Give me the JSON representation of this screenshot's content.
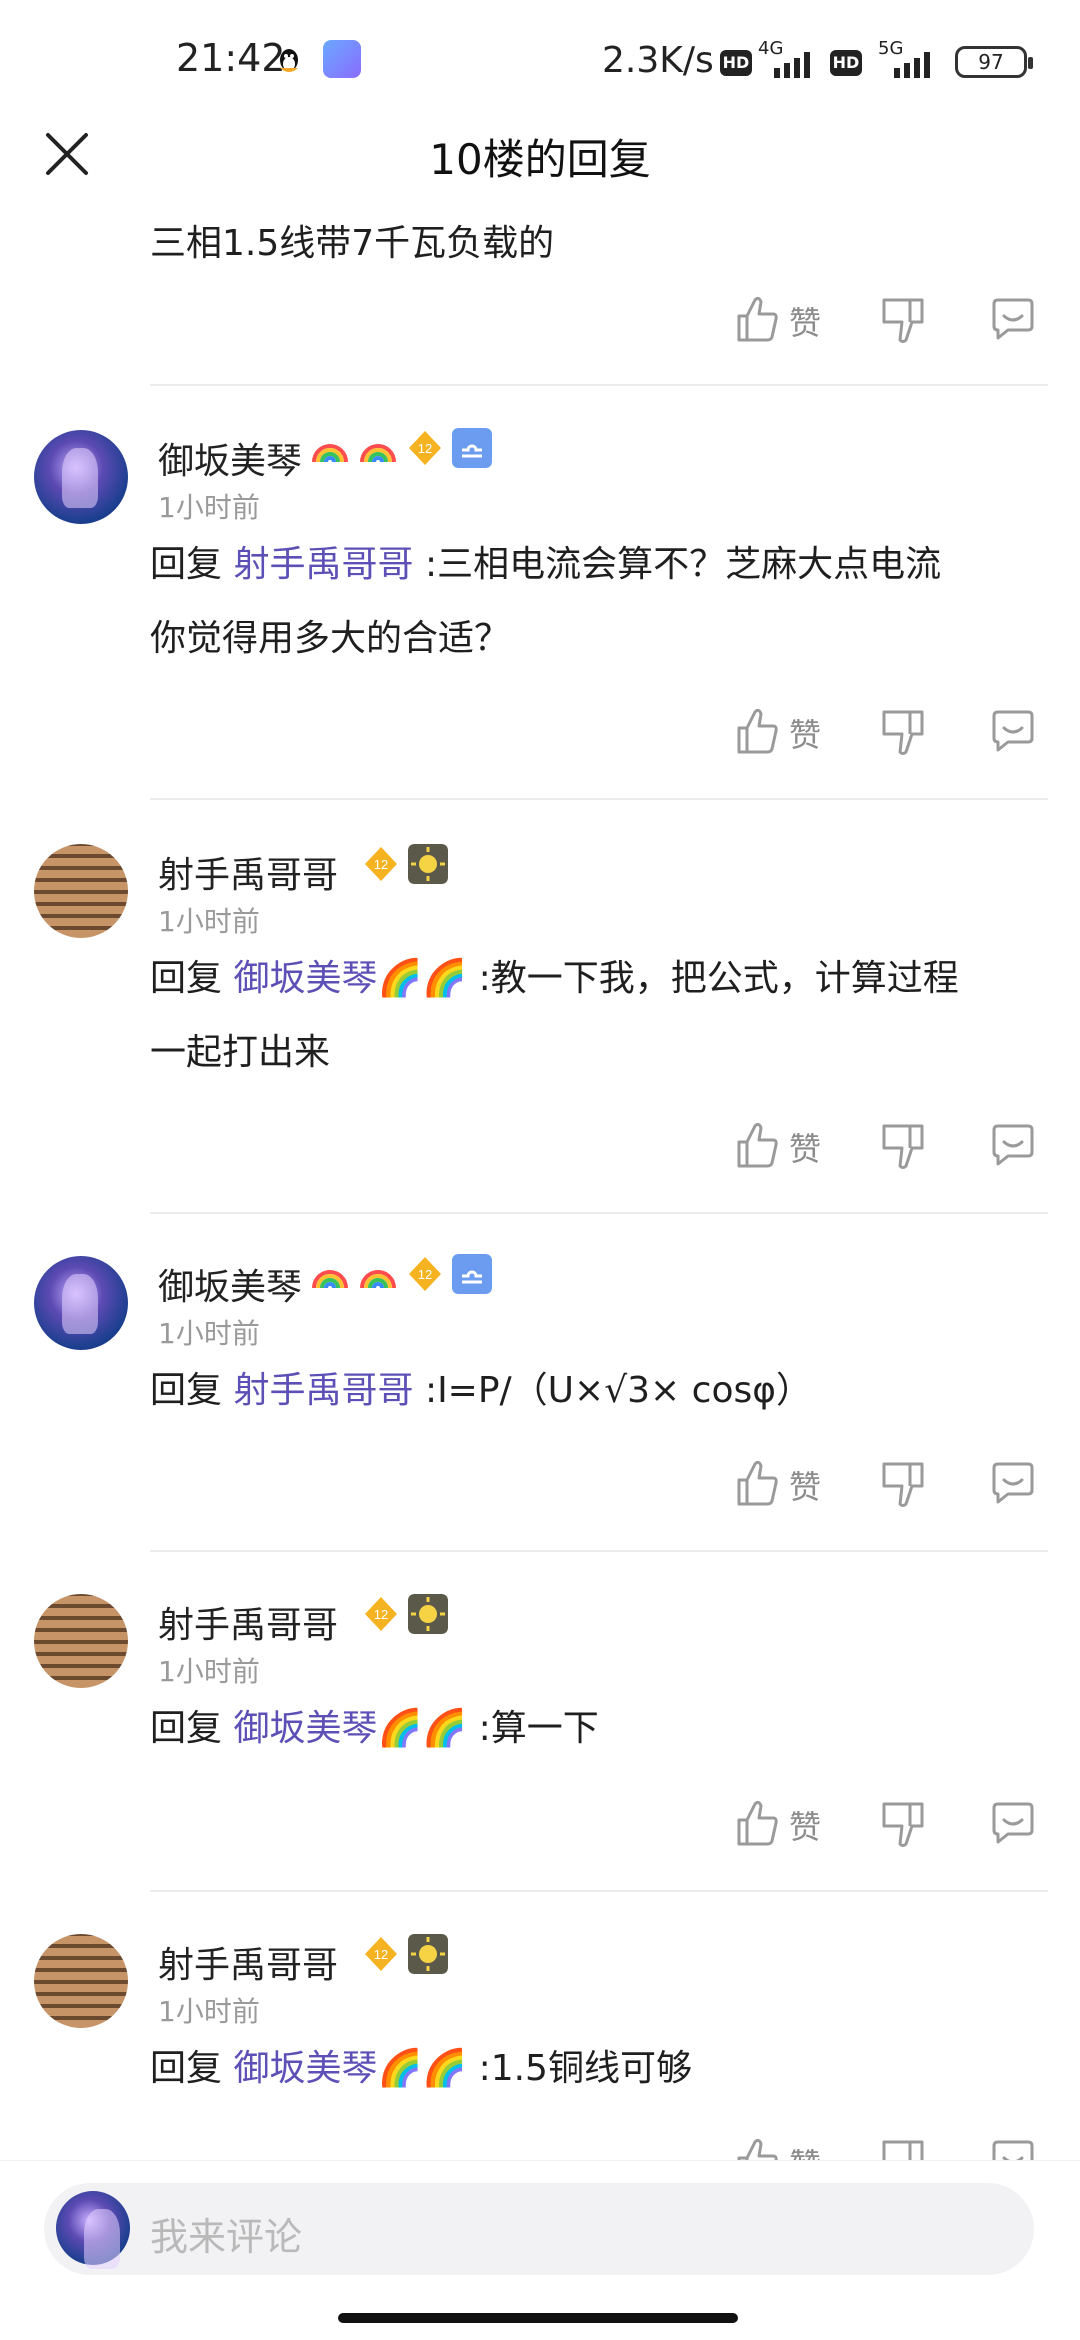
{
  "status_bar": {
    "time": "21:42",
    "net_speed": "2.3K/s",
    "sim1_type": "4G",
    "sim2_type": "5G",
    "hd1": "HD",
    "hd2": "HD",
    "battery": "97"
  },
  "header": {
    "title": "10楼的回复"
  },
  "first_item": {
    "text": "三相1.5线带7千瓦负载的",
    "like_label": "赞"
  },
  "replies": [
    {
      "user": "御坂美琴",
      "time": "1小时前",
      "prefix": "回复",
      "mention": "射手禹哥哥",
      "text_line1": ":三相电流会算不？芝麻大点电流",
      "text_line2": "你觉得用多大的合适？",
      "like_label": "赞"
    },
    {
      "user": "射手禹哥哥",
      "time": "1小时前",
      "prefix": "回复",
      "mention": "御坂美琴🌈🌈",
      "text_line1": ":教一下我，把公式，计算过程",
      "text_line2": "一起打出来",
      "like_label": "赞"
    },
    {
      "user": "御坂美琴",
      "time": "1小时前",
      "prefix": "回复",
      "mention": "射手禹哥哥",
      "text_line1": ":I=P/（U×√3× cosφ）",
      "like_label": "赞"
    },
    {
      "user": "射手禹哥哥",
      "time": "1小时前",
      "prefix": "回复",
      "mention": "御坂美琴🌈🌈",
      "text_line1": ":算一下",
      "like_label": "赞"
    },
    {
      "user": "射手禹哥哥",
      "time": "1小时前",
      "prefix": "回复",
      "mention": "御坂美琴🌈🌈",
      "text_line1": ":1.5铜线可够",
      "like_label": "赞"
    }
  ],
  "comment_bar": {
    "placeholder": "我来评论"
  },
  "colors": {
    "mention": "#5c50b6",
    "time": "#9a9a9a",
    "icon": "#9a9a9a",
    "level_badge": "#f5b321"
  }
}
